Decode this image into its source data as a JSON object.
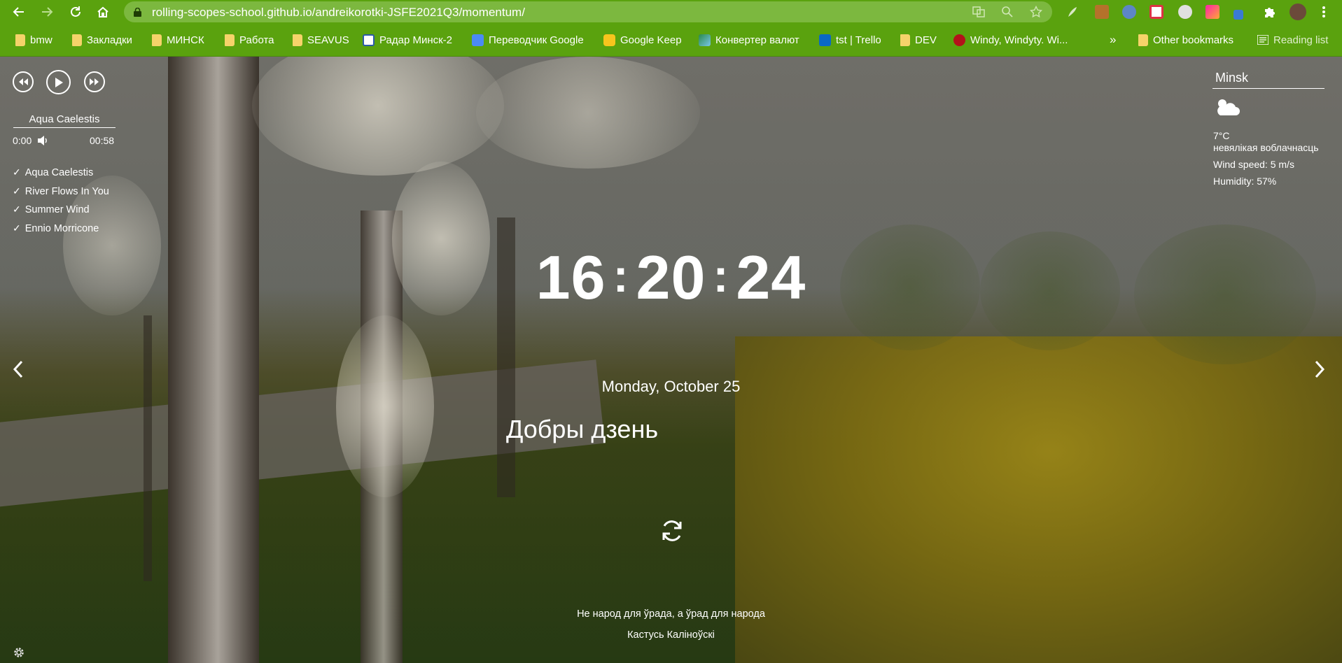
{
  "browser": {
    "url": "rolling-scopes-school.github.io/andreikorotki-JSFE2021Q3/momentum/",
    "bookmarks": [
      {
        "label": "bmw",
        "icon": "folder-icon"
      },
      {
        "label": "Закладки",
        "icon": "folder-icon"
      },
      {
        "label": "МИНСК",
        "icon": "folder-icon"
      },
      {
        "label": "Работа",
        "icon": "folder-icon"
      },
      {
        "label": "SEAVUS",
        "icon": "folder-icon"
      },
      {
        "label": "Радар Минск-2",
        "icon": "radar-favicon"
      },
      {
        "label": "Переводчик Google",
        "icon": "google-translate-favicon"
      },
      {
        "label": "Google Keep",
        "icon": "google-keep-favicon"
      },
      {
        "label": "Конвертер валют",
        "icon": "currency-converter-favicon"
      },
      {
        "label": "tst | Trello",
        "icon": "trello-favicon"
      },
      {
        "label": "DEV",
        "icon": "folder-icon"
      },
      {
        "label": "Windy, Windyty. Wi...",
        "icon": "windy-favicon"
      }
    ],
    "more_label": "»",
    "other_bookmarks": "Other bookmarks",
    "reading_list": "Reading list"
  },
  "player": {
    "current_title": "Aqua Caelestis",
    "current_time": "0:00",
    "duration": "00:58",
    "checkmark": "✓",
    "playlist": [
      "Aqua Caelestis",
      "River Flows In You",
      "Summer Wind",
      "Ennio Morricone"
    ]
  },
  "weather": {
    "city": "Minsk",
    "icon": "partly-cloudy-icon",
    "temperature": "7°C",
    "description": "невялікая воблачнасць",
    "wind": "Wind speed: 5 m/s",
    "humidity": "Humidity: 57%"
  },
  "time": {
    "hours": "16",
    "minutes": "20",
    "seconds": "24",
    "separator": ":"
  },
  "date": "Monday, October 25",
  "greeting": "Добры дзень",
  "quote": {
    "text": "Не народ для ўрада, а ўрад для народа",
    "author": "Кастусь Каліноўскі"
  },
  "colors": {
    "chrome": "#5aa20e",
    "omnibox": "#7cb83f",
    "text": "#ffffff"
  }
}
